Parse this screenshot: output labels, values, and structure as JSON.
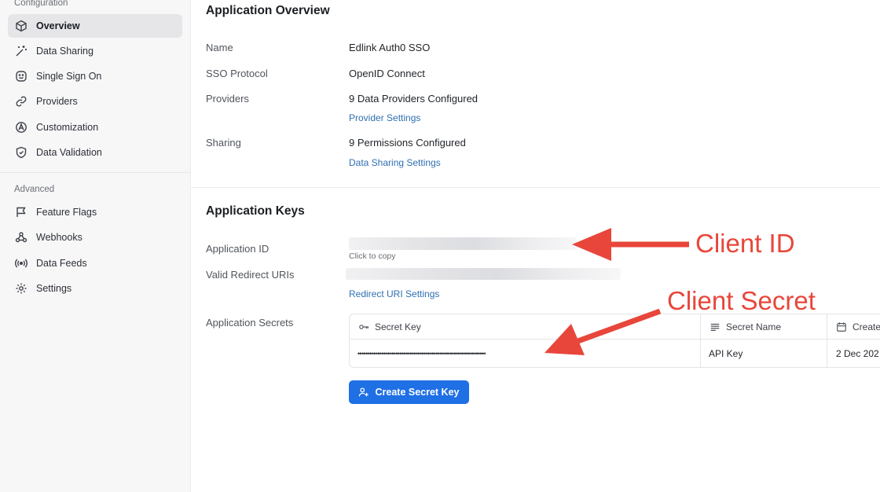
{
  "sidebar": {
    "section_configuration": "Configuration",
    "section_advanced": "Advanced",
    "items": [
      {
        "label": "Overview",
        "icon": "cube-icon",
        "active": true
      },
      {
        "label": "Data Sharing",
        "icon": "wand-icon"
      },
      {
        "label": "Single Sign On",
        "icon": "smiley-icon"
      },
      {
        "label": "Providers",
        "icon": "link-icon"
      },
      {
        "label": "Customization",
        "icon": "palette-icon"
      },
      {
        "label": "Data Validation",
        "icon": "shield-icon"
      }
    ],
    "advanced_items": [
      {
        "label": "Feature Flags",
        "icon": "flag-icon"
      },
      {
        "label": "Webhooks",
        "icon": "webhook-icon"
      },
      {
        "label": "Data Feeds",
        "icon": "broadcast-icon"
      },
      {
        "label": "Settings",
        "icon": "gear-icon"
      }
    ]
  },
  "overview": {
    "title": "Application Overview",
    "name_label": "Name",
    "name_value": "Edlink Auth0 SSO",
    "sso_label": "SSO Protocol",
    "sso_value": "OpenID Connect",
    "providers_label": "Providers",
    "providers_value": "9 Data Providers Configured",
    "providers_link": "Provider Settings",
    "sharing_label": "Sharing",
    "sharing_value": "9 Permissions Configured",
    "sharing_link": "Data Sharing Settings"
  },
  "keys": {
    "title": "Application Keys",
    "app_id_label": "Application ID",
    "click_to_copy": "Click to copy",
    "redirect_label": "Valid Redirect URIs",
    "redirect_link": "Redirect URI Settings",
    "secrets_label": "Application Secrets",
    "table": {
      "headers": {
        "secret_key": "Secret Key",
        "secret_name": "Secret Name",
        "created": "Create"
      },
      "rows": [
        {
          "secret_key": "••••••••••••••••••••••••••••••••••••••••••••••••••••••••••••••••",
          "secret_name": "API Key",
          "created": "2 Dec 202"
        }
      ]
    },
    "create_button": "Create Secret Key"
  },
  "annotations": {
    "client_id": "Client ID",
    "client_secret": "Client Secret",
    "color": "#e8463b"
  }
}
